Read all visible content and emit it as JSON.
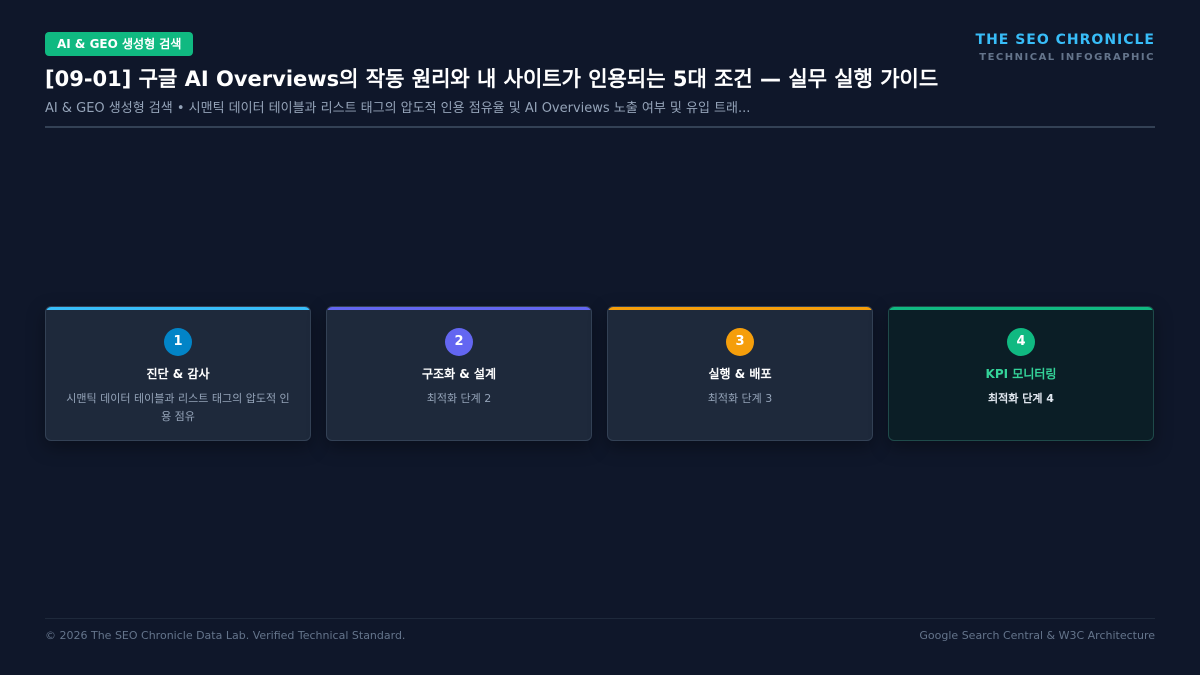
{
  "header": {
    "badge": "AI & GEO 생성형 검색",
    "brand_name": "THE SEO CHRONICLE",
    "brand_sub": "TECHNICAL INFOGRAPHIC",
    "title": "[09-01] 구글 AI Overviews의 작동 원리와 내 사이트가 인용되는 5대 조건 — 실무 실행 가이드",
    "subtitle": "AI & GEO 생성형 검색 • 시맨틱 데이터 테이블과 리스트 태그의 압도적 인용 점유율 및 AI Overviews 노출 여부 및 유입 트래..."
  },
  "steps": [
    {
      "number": "1",
      "title": "진단 & 감사",
      "desc": "시맨틱 데이터 테이블과 리스트 태그의 압도적 인용 점유",
      "color": "#0284c7",
      "bar": "#38bdf8"
    },
    {
      "number": "2",
      "title": "구조화 & 설계",
      "desc": "최적화 단계 2",
      "color": "#6366f1",
      "bar": "#6366f1"
    },
    {
      "number": "3",
      "title": "실행 & 배포",
      "desc": "최적화 단계 3",
      "color": "#f59e0b",
      "bar": "#f59e0b"
    },
    {
      "number": "4",
      "title": "KPI 모니터링",
      "desc": "최적화 단계 4",
      "color": "#10b981",
      "bar": "#10b981"
    }
  ],
  "footer": {
    "left": "© 2026 The SEO Chronicle Data Lab. Verified Technical Standard.",
    "right": "Google Search Central & W3C Architecture"
  }
}
